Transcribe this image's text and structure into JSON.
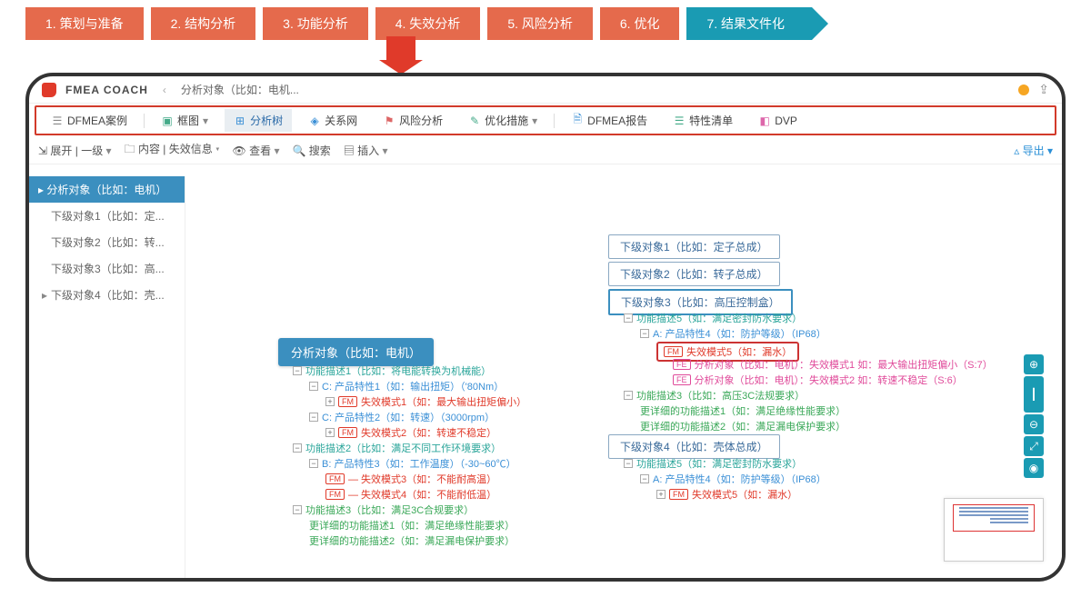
{
  "steps": [
    "1. 策划与准备",
    "2. 结构分析",
    "3. 功能分析",
    "4. 失效分析",
    "5. 风险分析",
    "6. 优化",
    "7. 结果文件化"
  ],
  "app": {
    "name": "FMEA COACH",
    "breadcrumb": "分析对象（比如：电机...",
    "sep": "‹"
  },
  "nav": {
    "left_label": "DFMEA案例",
    "items": [
      "框图",
      "分析树",
      "关系网",
      "风险分析",
      "优化措施",
      "DFMEA报告",
      "特性清单",
      "DVP"
    ],
    "active_index": 1
  },
  "toolbar": {
    "expand": "展开 | 一级",
    "content": "内容 | 失效信息",
    "view": "查看",
    "search": "搜索",
    "insert": "插入",
    "export": "导出"
  },
  "sidebar": {
    "head": "▸ 分析对象（比如：电机）",
    "items": [
      "下级对象1（比如：定...",
      "下级对象2（比如：转...",
      "下级对象3（比如：高...",
      "下级对象4（比如：壳..."
    ]
  },
  "main_node": "分析对象（比如：电机）",
  "left_tree": [
    {
      "t": "功能描述1（比如：将电能转换为机械能）",
      "cls": "c-teal",
      "pm": "-",
      "lvl": 0
    },
    {
      "t": "C: 产品特性1（如：输出扭矩）（'80Nm）",
      "cls": "c-blue",
      "pm": "-",
      "lvl": 1
    },
    {
      "t": "失效模式1（如：最大输出扭矩偏小）",
      "cls": "c-red",
      "pm": "+",
      "tag": "FM",
      "lvl": 2
    },
    {
      "t": "C: 产品特性2（如：转速）（3000rpm）",
      "cls": "c-blue",
      "pm": "-",
      "lvl": 1
    },
    {
      "t": "失效模式2（如：转速不稳定）",
      "cls": "c-red",
      "pm": "+",
      "tag": "FM",
      "lvl": 2
    },
    {
      "t": "功能描述2（比如：满足不同工作环境要求）",
      "cls": "c-teal",
      "pm": "-",
      "lvl": 0
    },
    {
      "t": "B: 产品特性3（如：工作温度）（-30~60℃）",
      "cls": "c-blue",
      "pm": "-",
      "lvl": 1
    },
    {
      "t": "— 失效模式3（如：不能耐高温）",
      "cls": "c-red",
      "pm": "",
      "tag": "FM",
      "lvl": 2
    },
    {
      "t": "— 失效模式4（如：不能耐低温）",
      "cls": "c-red",
      "pm": "",
      "tag": "FM",
      "lvl": 2
    },
    {
      "t": "功能描述3（比如：满足3C合规要求）",
      "cls": "c-green",
      "pm": "-",
      "lvl": 0
    },
    {
      "t": "更详细的功能描述1（如：满足绝缘性能要求）",
      "cls": "c-green",
      "pm": "",
      "lvl": 1
    },
    {
      "t": "更详细的功能描述2（如：满足漏电保护要求）",
      "cls": "c-green",
      "pm": "",
      "lvl": 1
    }
  ],
  "subs": [
    {
      "t": "下级对象1（比如：定子总成）"
    },
    {
      "t": "下级对象2（比如：转子总成）"
    },
    {
      "t": "下级对象3（比如：高压控制盒）",
      "sel": true
    },
    {
      "t": "下级对象4（比如：壳体总成）"
    }
  ],
  "right3": [
    {
      "t": "功能描述5（如：满足密封防水要求）",
      "cls": "c-teal",
      "pm": "-",
      "lvl": 0
    },
    {
      "t": "A: 产品特性4（如：防护等级）（IP68）",
      "cls": "c-blue",
      "pm": "-",
      "lvl": 1
    },
    {
      "t": "失效模式5（如：漏水）",
      "cls": "c-red",
      "pm": "",
      "tag": "FM",
      "lvl": 2,
      "boxed": true
    },
    {
      "t": "分析对象（比如：电机）：失效模式1 如：最大输出扭矩偏小（S:7）",
      "cls": "c-pink",
      "pm": "",
      "tag": "FE",
      "lvl": 3
    },
    {
      "t": "分析对象（比如：电机）：失效模式2 如：转速不稳定（S:6）",
      "cls": "c-pink",
      "pm": "",
      "tag": "FE",
      "lvl": 3
    },
    {
      "t": "功能描述3（比如：高压3C法规要求）",
      "cls": "c-green",
      "pm": "-",
      "lvl": 0
    },
    {
      "t": "更详细的功能描述1（如：满足绝缘性能要求）",
      "cls": "c-green",
      "pm": "",
      "lvl": 1
    },
    {
      "t": "更详细的功能描述2（如：满足漏电保护要求）",
      "cls": "c-green",
      "pm": "",
      "lvl": 1
    }
  ],
  "right4": [
    {
      "t": "功能描述5（如：满足密封防水要求）",
      "cls": "c-teal",
      "pm": "-",
      "lvl": 0
    },
    {
      "t": "A: 产品特性4（如：防护等级）（IP68）",
      "cls": "c-blue",
      "pm": "-",
      "lvl": 1
    },
    {
      "t": "失效模式5（如：漏水）",
      "cls": "c-red",
      "pm": "+",
      "tag": "FM",
      "lvl": 2
    }
  ]
}
